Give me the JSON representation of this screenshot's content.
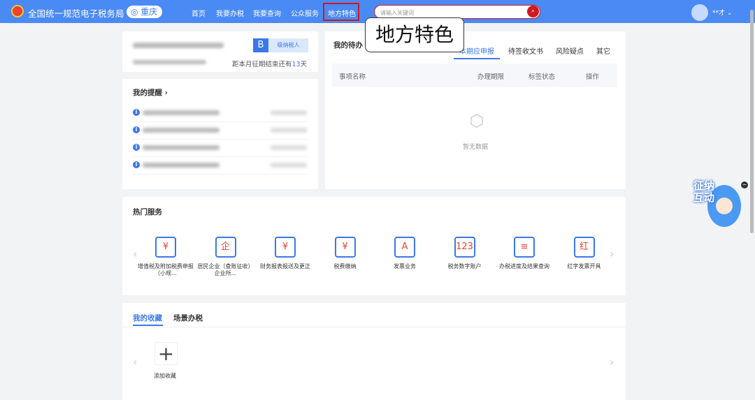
{
  "header": {
    "title": "全国统一规范电子税务局",
    "city": "重庆",
    "nav": [
      "首页",
      "我要办税",
      "我要查询",
      "公众服务",
      "地方特色"
    ],
    "search_placeholder": "请输入关键词",
    "user": "**才"
  },
  "callout": "地方特色",
  "taxpayer": {
    "grade": "B",
    "grade_label": "级纳税人",
    "deadline_prefix": "距本月征期结束还有",
    "deadline_days": "13",
    "deadline_suffix": "天"
  },
  "reminders": {
    "title": "我的提醒 ›"
  },
  "todo": {
    "title": "我的待办",
    "tabs": [
      "本期应申报",
      "待签收文书",
      "风险疑点",
      "其它"
    ],
    "columns": [
      "事项名称",
      "办理期限",
      "标签状态",
      "操作"
    ],
    "empty": "暂无数据"
  },
  "hot": {
    "title": "热门服务",
    "items": [
      {
        "label": "增值税及附加税费申报（小规...",
        "icon": "¥"
      },
      {
        "label": "居民企业（查账征收）企业所...",
        "icon": "企"
      },
      {
        "label": "财务报表报送及更正",
        "icon": "¥"
      },
      {
        "label": "税费缴纳",
        "icon": "¥"
      },
      {
        "label": "发票业务",
        "icon": "A"
      },
      {
        "label": "税务数字账户",
        "icon": "123"
      },
      {
        "label": "办税进度及结果查询",
        "icon": "≡"
      },
      {
        "label": "红字发票开具",
        "icon": "红"
      }
    ]
  },
  "favorites": {
    "tabs": [
      "我的收藏",
      "场景办税"
    ],
    "add_label": "添加收藏"
  },
  "assistant": {
    "text": "征纳互动"
  }
}
